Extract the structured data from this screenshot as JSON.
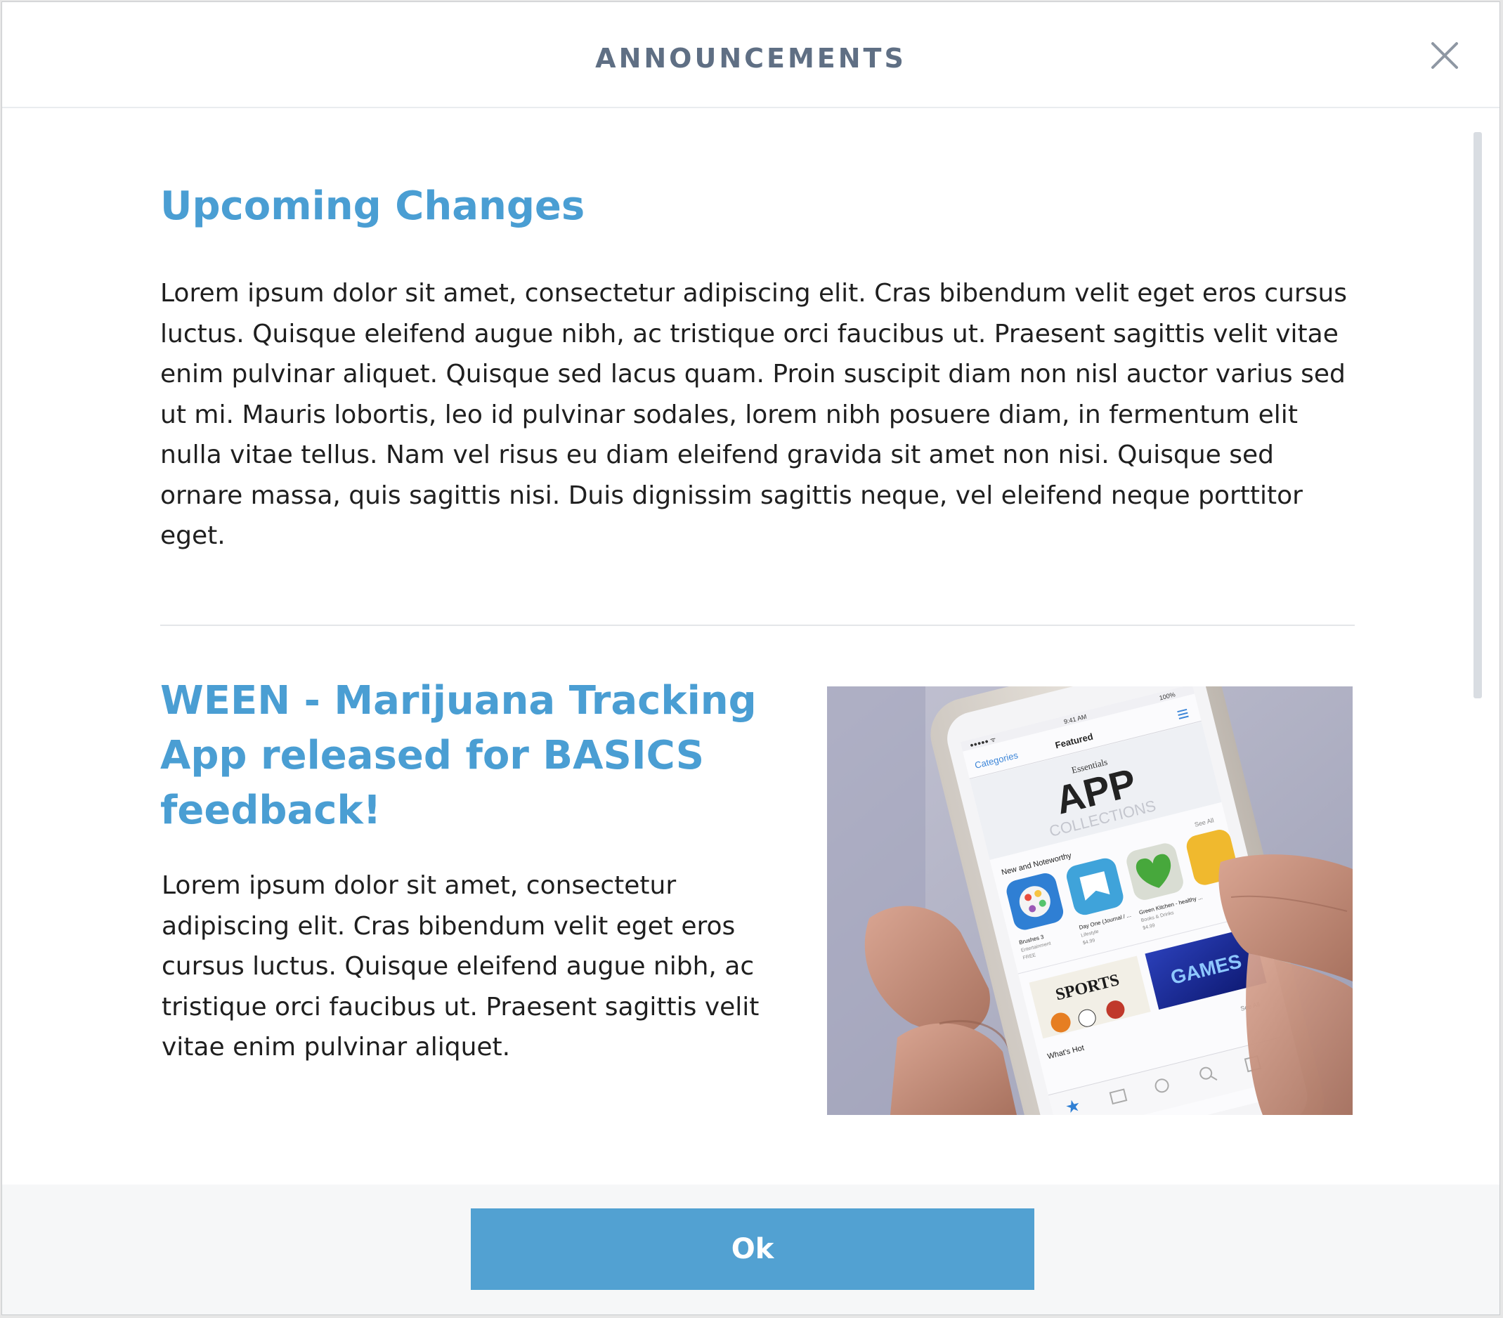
{
  "dialog": {
    "title": "ANNOUNCEMENTS",
    "close_icon": "close-icon"
  },
  "announcements": [
    {
      "title": "Upcoming Changes",
      "body": "Lorem ipsum dolor sit amet, consectetur adipiscing elit. Cras bibendum velit eget eros cursus luctus. Quisque eleifend augue nibh, ac tristique orci faucibus ut. Praesent sagittis velit vitae enim pulvinar aliquet. Quisque sed lacus quam. Proin suscipit diam non nisl auctor varius sed ut mi. Mauris lobortis, leo id pulvinar sodales, lorem nibh posuere diam, in fermentum elit nulla vitae tellus. Nam vel risus eu diam eleifend gravida sit amet non nisi. Quisque sed ornare massa, quis sagittis nisi. Duis dignissim sagittis neque, vel eleifend neque porttitor eget."
    },
    {
      "title": "WEEN - Marijuana Tracking App released for BASICS feedback!",
      "body": "Lorem ipsum dolor sit amet, consectetur adipiscing elit. Cras bibendum velit eget eros cursus luctus. Quisque eleifend augue nibh, ac tristique orci faucibus ut. Praesent sagittis velit vitae enim pulvinar aliquet.",
      "image": {
        "status_time": "9:41 AM",
        "battery": "100%",
        "nav_left": "Categories",
        "nav_title": "Featured",
        "banner_kicker": "Essentials",
        "banner_title": "APP",
        "banner_subtitle": "COLLECTIONS",
        "section_label": "New and Noteworthy",
        "see_all": "See All",
        "apps": [
          {
            "name": "Brushes 3",
            "category": "Entertainment",
            "price": "FREE"
          },
          {
            "name": "Day One (Journal / ...",
            "category": "Lifestyle",
            "price": "$4.99"
          },
          {
            "name": "Green Kitchen - healthy ...",
            "category": "Books & Drinks",
            "price": "$4.99"
          }
        ],
        "tile_sports": "SPORTS",
        "tile_games": "GAMES",
        "hot_label": "What's Hot",
        "hot_see_all": "See All"
      }
    }
  ],
  "footer": {
    "ok_label": "Ok"
  },
  "colors": {
    "accent": "#52a1d2",
    "heading": "#4a9ed3",
    "title_text": "#5f6f84"
  }
}
